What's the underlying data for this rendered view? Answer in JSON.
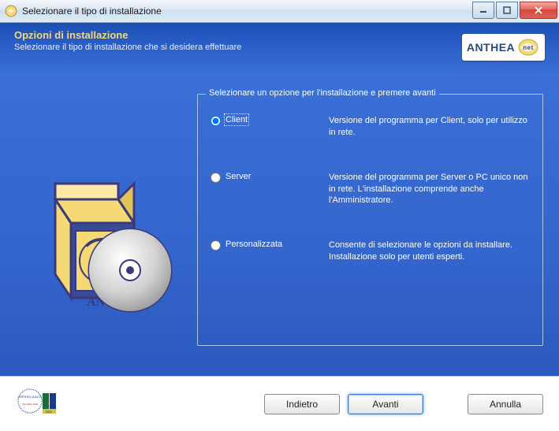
{
  "window": {
    "title": "Selezionare il tipo di installazione"
  },
  "header": {
    "title": "Opzioni di installazione",
    "subtitle": "Selezionare il tipo di installazione che si desidera effettuare",
    "brand_main": "ANTHEA",
    "brand_suffix": "net"
  },
  "fieldset": {
    "legend": "Selezionare un opzione per l'installazione e premere avanti"
  },
  "options": {
    "client": {
      "label": "Client",
      "desc": "Versione del programma per Client, solo per utilizzo in rete.",
      "selected": true
    },
    "server": {
      "label": "Server",
      "desc": "Versione del programma per Server o PC unico non in rete. L'installazione comprende anche l'Amministratore.",
      "selected": false
    },
    "personalizzata": {
      "label": "Personalizzata",
      "desc": "Consente di selezionare le opzioni da installare. Installazione solo per utenti esperti.",
      "selected": false
    }
  },
  "buttons": {
    "back": "Indietro",
    "next": "Avanti",
    "cancel": "Annulla"
  }
}
